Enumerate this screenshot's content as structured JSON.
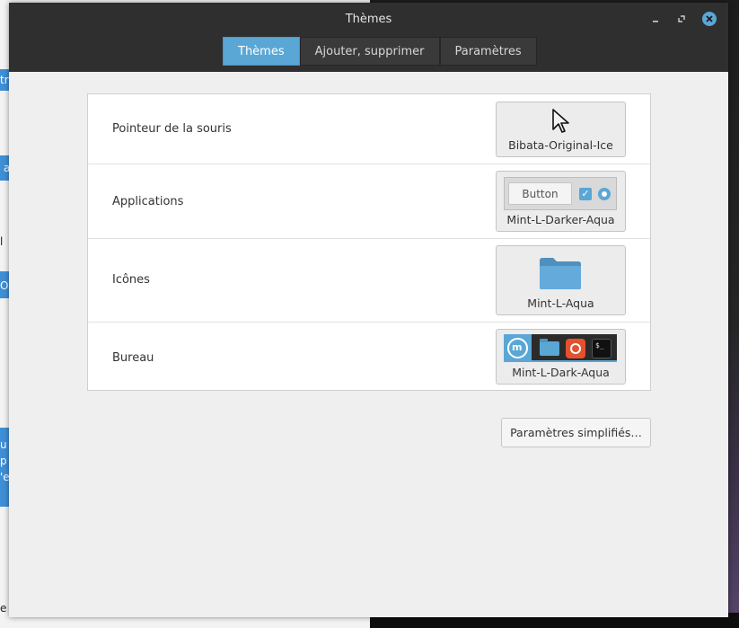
{
  "window": {
    "title": "Thèmes"
  },
  "tabs": [
    {
      "label": "Thèmes",
      "active": true
    },
    {
      "label": "Ajouter, supprimer",
      "active": false
    },
    {
      "label": "Paramètres",
      "active": false
    }
  ],
  "rows": [
    {
      "label": "Pointeur de la souris",
      "theme": "Bibata-Original-Ice",
      "preview": "cursor-arrow-icon"
    },
    {
      "label": "Applications",
      "theme": "Mint-L-Darker-Aqua",
      "preview": "widget-preview",
      "preview_button": "Button"
    },
    {
      "label": "Icônes",
      "theme": "Mint-L-Aqua",
      "preview": "folder-icon"
    },
    {
      "label": "Bureau",
      "theme": "Mint-L-Dark-Aqua",
      "preview": "panel-preview",
      "terminal_prompt": "$_"
    }
  ],
  "simple_settings_button": "Paramètres simplifiés…",
  "background_fragments": {
    "left_tabs": [
      "tr",
      "a",
      "l",
      "Ou",
      "u",
      "p",
      "'e"
    ],
    "bottom_text": "e"
  },
  "colors": {
    "accent": "#5aa7d6",
    "titlebar": "#2f2f2f",
    "window_bg": "#efefef"
  }
}
